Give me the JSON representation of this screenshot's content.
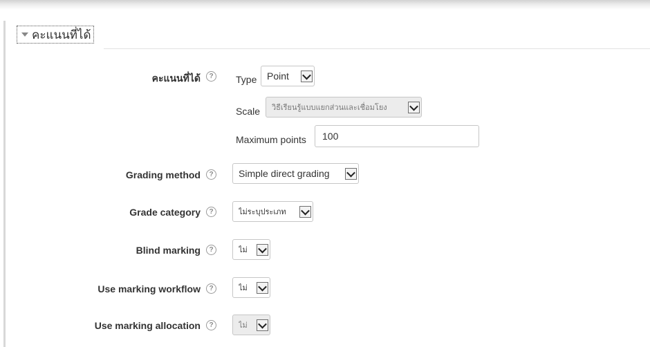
{
  "section": {
    "title": "คะแนนที่ได้"
  },
  "grade": {
    "label": "คะแนนที่ได้",
    "help_icon": "question-circle-icon",
    "type_label": "Type",
    "type_value": "Point",
    "scale_label": "Scale",
    "scale_value": "วิธีเรียนรู้แบบแยกส่วนและเชื่อมโยง",
    "max_points_label": "Maximum points",
    "max_points_value": "100"
  },
  "grading_method": {
    "label": "Grading method",
    "value": "Simple direct grading"
  },
  "grade_category": {
    "label": "Grade category",
    "value": "ไม่ระบุประเภท"
  },
  "blind_marking": {
    "label": "Blind marking",
    "value": "ไม่"
  },
  "marking_workflow": {
    "label": "Use marking workflow",
    "value": "ไม่"
  },
  "marking_allocation": {
    "label": "Use marking allocation",
    "value": "ไม่"
  },
  "colors": {
    "border": "#c6c6c6",
    "disabled_bg": "#ececec",
    "text": "#333333"
  }
}
